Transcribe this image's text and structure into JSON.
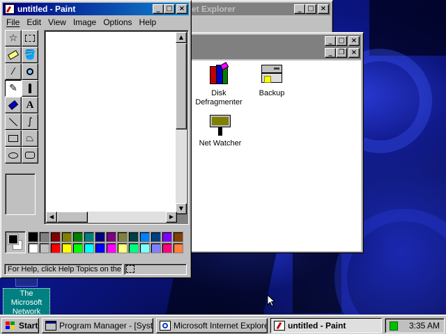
{
  "desktop": {
    "icon_label_line1": "The Microsoft",
    "icon_label_line2": "Network"
  },
  "ie_window": {
    "title": "Microsoft Internet Explorer",
    "visible_title": "et Explorer"
  },
  "accessories_window": {
    "items": [
      {
        "label_line1": "Disk",
        "label_line2": "Defragmenter",
        "icon": "disk-defragmenter-icon"
      },
      {
        "label_line1": "Backup",
        "label_line2": "",
        "icon": "backup-icon"
      },
      {
        "label_line1": "Net Watcher",
        "label_line2": "",
        "icon": "net-watcher-icon"
      }
    ]
  },
  "paint": {
    "title": "untitled - Paint",
    "menu": [
      "File",
      "Edit",
      "View",
      "Image",
      "Options",
      "Help"
    ],
    "tools": [
      "free-form-select",
      "select",
      "eraser",
      "fill-with-color",
      "pick-color",
      "magnifier",
      "pencil",
      "brush",
      "airbrush",
      "text",
      "line",
      "curve",
      "rectangle",
      "polygon",
      "ellipse",
      "rounded-rectangle"
    ],
    "selected_tool": "pencil",
    "palette": {
      "row1": [
        "#000000",
        "#808080",
        "#800000",
        "#808000",
        "#008000",
        "#008080",
        "#000080",
        "#800080",
        "#808040",
        "#004040",
        "#0080ff",
        "#004080",
        "#8000ff",
        "#804000"
      ],
      "row2": [
        "#ffffff",
        "#c0c0c0",
        "#ff0000",
        "#ffff00",
        "#00ff00",
        "#00ffff",
        "#0000ff",
        "#ff00ff",
        "#ffff80",
        "#00ff80",
        "#80ffff",
        "#8080ff",
        "#ff0080",
        "#ff8040"
      ]
    },
    "foreground_color": "#000000",
    "background_color": "#ffffff",
    "status_text": "For Help, click Help Topics on the"
  },
  "taskbar": {
    "start_label": "Start",
    "tasks": [
      {
        "label": "Program Manager - [Syste...",
        "active": false
      },
      {
        "label": "Microsoft Internet Explorer ...",
        "active": false
      },
      {
        "label": "untitled - Paint",
        "active": true
      }
    ],
    "clock": "3:35 AM"
  }
}
